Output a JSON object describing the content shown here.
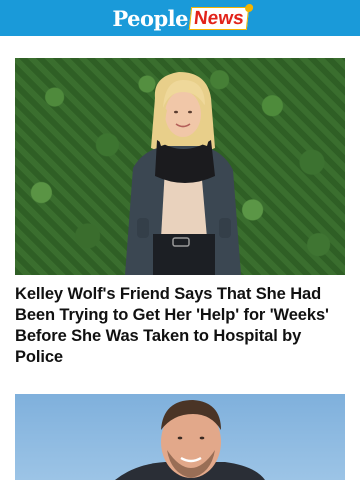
{
  "header": {
    "logo_people": "People",
    "logo_news": "News",
    "background_color": "#1a9ad9"
  },
  "articles": [
    {
      "headline": "Kelley Wolf's Friend Says That She Had Been Trying to Get Her 'Help' for 'Weeks' Before She Was Taken to Hospital by Police"
    }
  ]
}
